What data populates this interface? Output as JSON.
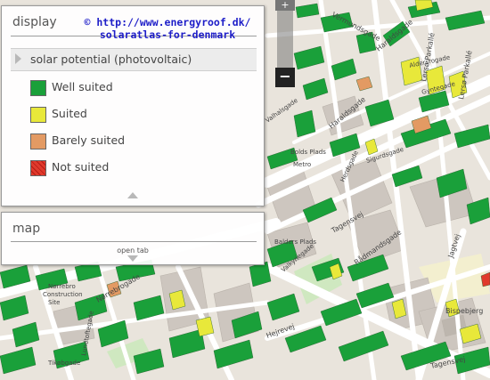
{
  "display_panel": {
    "title": "display",
    "layer": "solar potential (photovoltaic)",
    "legend": [
      {
        "label": "Well suited",
        "color": "#1aa03a"
      },
      {
        "label": "Suited",
        "color": "#e8e83a"
      },
      {
        "label": "Barely suited",
        "color": "#e39a63"
      },
      {
        "label": "Not suited",
        "color": "#e03a2c"
      }
    ]
  },
  "map_panel": {
    "title": "map",
    "open_tab": "open tab"
  },
  "credit": {
    "line1": "© http://www.energyroof.dk/",
    "line2": "solaratlas-for-denmark"
  },
  "zoom": {
    "plus": "+",
    "minus": "−"
  },
  "streets": [
    {
      "name": "Vermundsgade"
    },
    {
      "name": "Haraldsgade"
    },
    {
      "name": "Aldersrogade"
    },
    {
      "name": "Lersø Parkallé"
    },
    {
      "name": "Lersø Parkallé"
    },
    {
      "name": "Gyntegade"
    },
    {
      "name": "Valhalsgade"
    },
    {
      "name": "Haraldsgade"
    },
    {
      "name": "Sigurdsgade"
    },
    {
      "name": "Bolds Plads"
    },
    {
      "name": "Metro"
    },
    {
      "name": "Herdsgade"
    },
    {
      "name": "Tagensvej"
    },
    {
      "name": "Balders Plads"
    },
    {
      "name": "Rådmandsgade"
    },
    {
      "name": "Valkyriegade"
    },
    {
      "name": "Nørrebrogade"
    },
    {
      "name": "Nørrebro"
    },
    {
      "name": "Construction"
    },
    {
      "name": "Site"
    },
    {
      "name": "Tikøbgade"
    },
    {
      "name": "Lundtoftegade"
    },
    {
      "name": "Hejrevej"
    },
    {
      "name": "Jagtvej"
    },
    {
      "name": "Bispebjerg"
    },
    {
      "name": "Tagensvej"
    }
  ],
  "colors": {
    "well": "#1aa03a",
    "suited": "#e8e83a",
    "barely": "#e39a63",
    "not": "#e03a2c",
    "land": "#e9e4dc",
    "road": "#ffffff",
    "building": "#cdc6bf"
  }
}
